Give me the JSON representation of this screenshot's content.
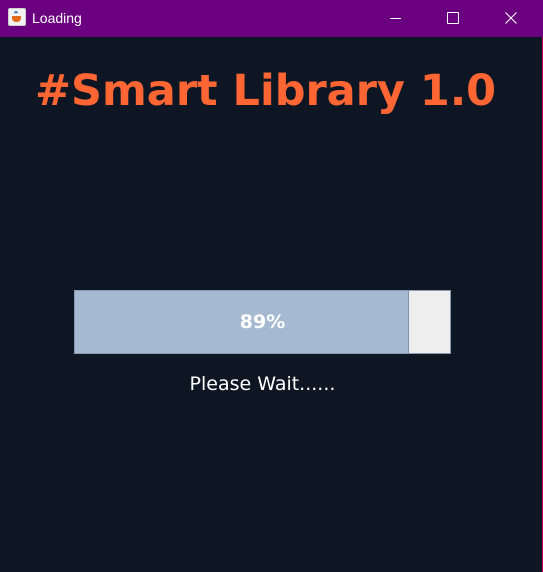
{
  "window": {
    "title": "Loading",
    "app_icon": "java-cup-icon"
  },
  "controls": {
    "minimize_icon": "minimize-icon",
    "maximize_icon": "maximize-icon",
    "close_icon": "close-icon"
  },
  "main": {
    "heading": "#Smart Library 1.0",
    "progress_value": 89,
    "progress_label": "89%",
    "status_text": "Please Wait......"
  },
  "colors": {
    "titlebar": "#6a0080",
    "background": "#0e1624",
    "heading": "#ff6633",
    "progress_fill": "#a5b9d1",
    "progress_track": "#eeeeee"
  }
}
